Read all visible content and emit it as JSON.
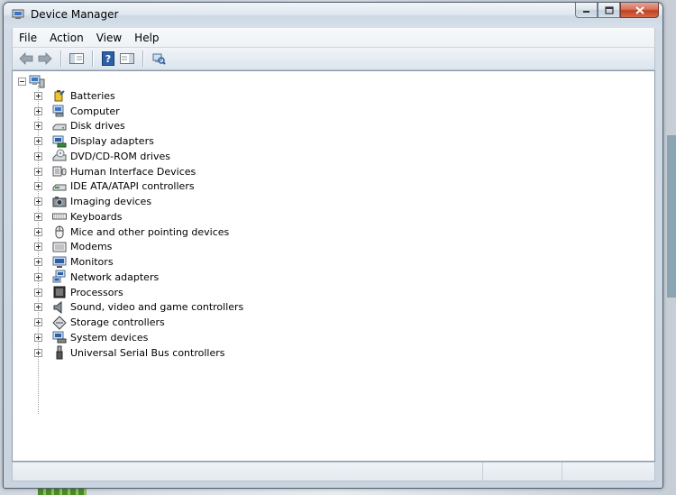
{
  "window": {
    "title": "Device Manager"
  },
  "menu": {
    "items": [
      "File",
      "Action",
      "View",
      "Help"
    ]
  },
  "tree": {
    "categories": [
      {
        "label": "Batteries",
        "icon": "battery-icon"
      },
      {
        "label": "Computer",
        "icon": "computer-icon"
      },
      {
        "label": "Disk drives",
        "icon": "disk-drive-icon"
      },
      {
        "label": "Display adapters",
        "icon": "display-adapter-icon"
      },
      {
        "label": "DVD/CD-ROM drives",
        "icon": "dvd-drive-icon"
      },
      {
        "label": "Human Interface Devices",
        "icon": "hid-icon"
      },
      {
        "label": "IDE ATA/ATAPI controllers",
        "icon": "ide-controller-icon"
      },
      {
        "label": "Imaging devices",
        "icon": "imaging-device-icon"
      },
      {
        "label": "Keyboards",
        "icon": "keyboard-icon"
      },
      {
        "label": "Mice and other pointing devices",
        "icon": "mouse-icon"
      },
      {
        "label": "Modems",
        "icon": "modem-icon"
      },
      {
        "label": "Monitors",
        "icon": "monitor-icon"
      },
      {
        "label": "Network adapters",
        "icon": "network-adapter-icon"
      },
      {
        "label": "Processors",
        "icon": "processor-icon"
      },
      {
        "label": "Sound, video and game controllers",
        "icon": "sound-icon"
      },
      {
        "label": "Storage controllers",
        "icon": "storage-controller-icon"
      },
      {
        "label": "System devices",
        "icon": "system-device-icon"
      },
      {
        "label": "Universal Serial Bus controllers",
        "icon": "usb-icon"
      }
    ]
  },
  "colors": {
    "accent": "#2b5fa8",
    "close_button": "#c2401f"
  }
}
